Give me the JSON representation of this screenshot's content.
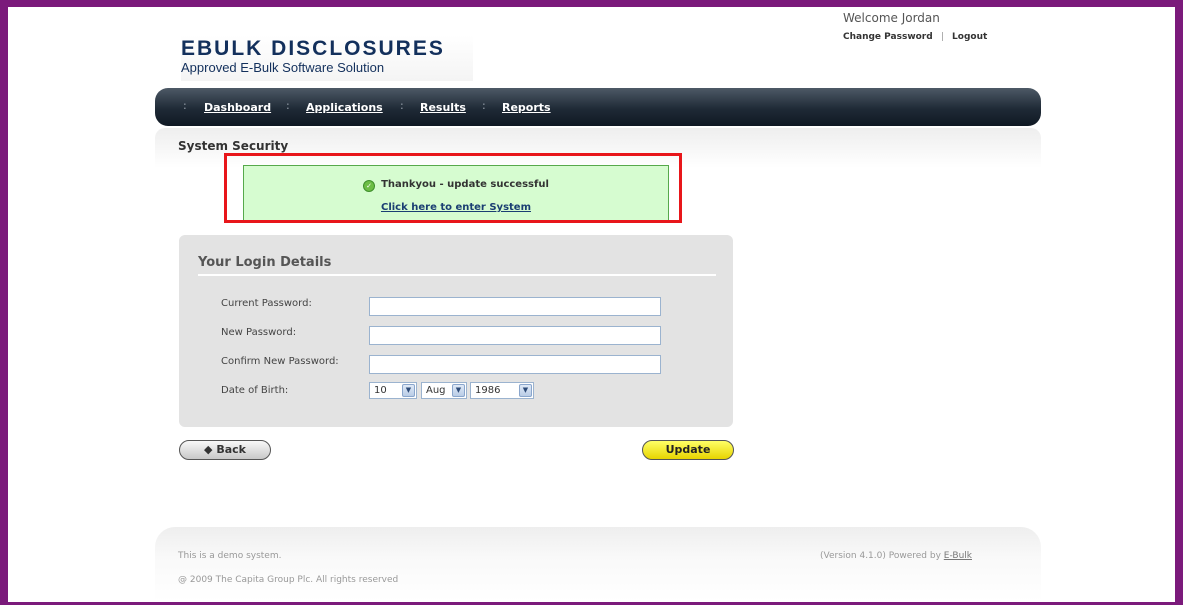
{
  "header": {
    "logo_title": "EBULK DISCLOSURES",
    "logo_subtitle": "Approved E-Bulk Software Solution",
    "welcome": "Welcome Jordan",
    "change_password": "Change Password",
    "separator": "|",
    "logout": "Logout"
  },
  "nav": {
    "separator": ":",
    "items": [
      {
        "label": "Dashboard"
      },
      {
        "label": "Applications"
      },
      {
        "label": "Results"
      },
      {
        "label": "Reports"
      }
    ]
  },
  "page": {
    "title": "System Security"
  },
  "alert": {
    "icon": "check-circle-icon",
    "message": "Thankyou - update successful",
    "link": "Click here to enter System",
    "highlight_color": "#e8161a",
    "background_color": "#d6fcd0"
  },
  "login_details": {
    "title": "Your Login Details",
    "fields": [
      {
        "label": "Current Password:",
        "value": ""
      },
      {
        "label": "New Password:",
        "value": ""
      },
      {
        "label": "Confirm New Password:",
        "value": ""
      }
    ],
    "dob": {
      "label": "Date of Birth:",
      "day": "10",
      "month": "Aug",
      "year": "1986"
    }
  },
  "buttons": {
    "back": "◆ Back",
    "update": "Update"
  },
  "footer": {
    "demo_notice": "This is a demo system.",
    "copyright": "@ 2009 The Capita Group Plc. All rights reserved",
    "version": "(Version 4.1.0) Powered by",
    "powered_link": "E-Bulk"
  },
  "colors": {
    "frame": "#7b1a7b",
    "brand": "#13305c",
    "update_button": "#ffff33"
  }
}
